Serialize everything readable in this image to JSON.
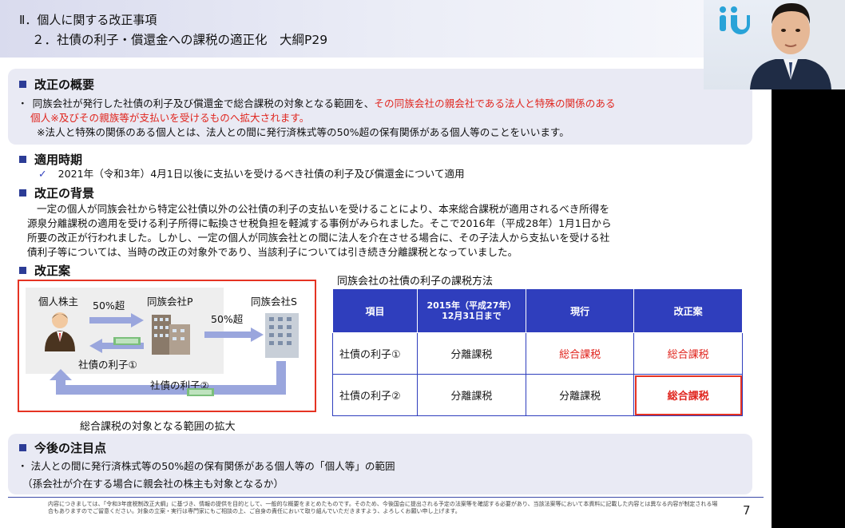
{
  "header": {
    "line1": "Ⅱ．個人に関する改正事項",
    "line2": "２．社債の利子・償還金への課税の適正化　大綱P29"
  },
  "overview": {
    "title": "改正の概要",
    "bullet": "・",
    "line1a": "同族会社が発行した社債の利子及び償還金で総合課税の対象となる範囲を、",
    "line1b": "その同族会社の親会社である法人と特殊の関係のある",
    "line2": "個人※及びその親族等が支払いを受けるものへ拡大されます。",
    "note": "※法人と特殊の関係のある個人とは、法人との間に発行済株式等の50%超の保有関係がある個人等のことをいいます。"
  },
  "timing": {
    "title": "適用時期",
    "check": "✓",
    "text": "2021年（令和3年）4月1日以後に支払いを受けるべき社債の利子及び償還金について適用"
  },
  "background": {
    "title": "改正の背景",
    "lines": [
      "一定の個人が同族会社から特定公社債以外の公社債の利子の支払いを受けることにより、本来総合課税が適用されるべき所得を",
      "源泉分離課税の適用を受ける利子所得に転換させ税負担を軽減する事例がみられました。そこで2016年（平成28年）1月1日から",
      "所要の改正が行われました。しかし、一定の個人が同族会社との間に法人を介在させる場合に、その子法人から支払いを受ける社",
      "債利子等については、当時の改正の対象外であり、当該利子については引き続き分離課税となっていました。"
    ]
  },
  "proposal": {
    "title": "改正案"
  },
  "diagram": {
    "shareholder": "個人株主",
    "pct1": "50%超",
    "companyP": "同族会社P",
    "companyS": "同族会社S",
    "pct2": "50%超",
    "interest1": "社債の利子①",
    "interest2": "社債の利子②",
    "caption": "総合課税の対象となる範囲の拡大"
  },
  "table": {
    "caption": "同族会社の社債の利子の課税方法",
    "headers": [
      "項目",
      "2015年（平成27年）\n12月31日まで",
      "現行",
      "改正案"
    ],
    "rows": [
      [
        "社債の利子①",
        "分離課税",
        "総合課税",
        "総合課税"
      ],
      [
        "社債の利子②",
        "分離課税",
        "分離課税",
        "総合課税"
      ]
    ]
  },
  "focus": {
    "title": "今後の注目点",
    "line1": "・ 法人との間に発行済株式等の50%超の保有関係がある個人等の「個人等」の範囲",
    "line2": "（孫会社が介在する場合に親会社の株主も対象となるか）"
  },
  "footer": {
    "text": "内容につきましては、「令和3年度税制改正大綱」に基づき、情報の提供を目的として、一般的な概要をまとめたものです。そのため、今後国会に提出される予定の法案等を確認する必要があり、当該法案等において本資料に記載した内容とは異なる内容が制定される場合もありますのでご留意ください。対象の立案・実行は専門家にもご相談の上、ご自身の責任において取り組んでいただきますよう、よろしくお願い申し上げます。",
    "page": "7"
  },
  "colors": {
    "accent": "#2f3ebd",
    "red": "#e0261f",
    "panel": "#e9eaf4"
  }
}
